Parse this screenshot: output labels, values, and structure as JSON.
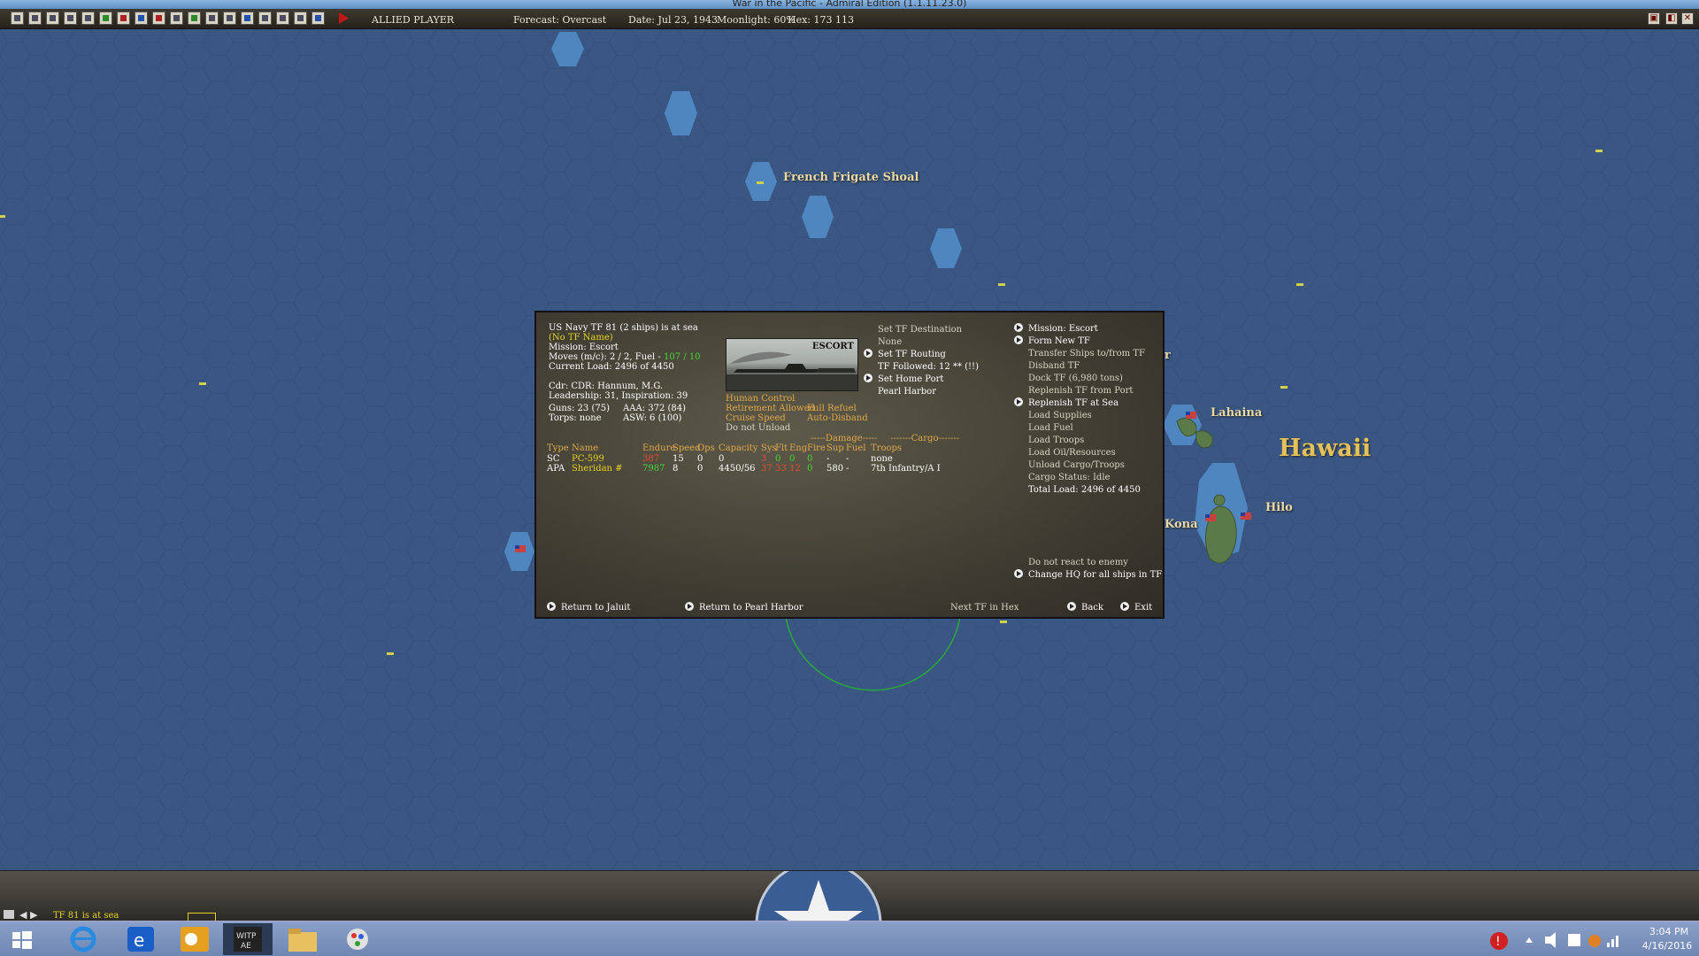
{
  "window": {
    "title": "War in the Pacific - Admiral Edition (1.1.11.23.0)"
  },
  "toolbar": {
    "player": "ALLIED PLAYER",
    "forecast": "Forecast: Overcast",
    "date": "Date: Jul 23, 1943",
    "moonlight": "Moonlight: 60%",
    "hex": "Hex: 173 113"
  },
  "map": {
    "labels": {
      "french_frigate_shoal": "French Frigate Shoal",
      "lahaina": "Lahaina",
      "hawaii": "Hawaii",
      "hilo": "Hilo",
      "kona": "Kona",
      "partial_r": "r"
    }
  },
  "panel": {
    "header": {
      "line1": "US Navy TF 81 (2 ships) is at sea",
      "tf_name": "(No TF Name)",
      "mission": "Mission: Escort",
      "moves_prefix": "Moves (m/c): 2 / 2, Fuel -",
      "moves_fuel": "107 / 10",
      "current_load": "Current Load: 2496 of 4450",
      "cdr": "Cdr: CDR: Hannum, M.G.",
      "leadership": "Leadership: 31, Inspiration: 39",
      "guns": "Guns: 23 (75)",
      "aaa": "AAA: 372 (84)",
      "torps": "Torps: none",
      "asw": "ASW: 6 (100)"
    },
    "image_label": "ESCORT",
    "settings": {
      "human_control": "Human Control",
      "retirement": "Retirement Allowed",
      "cruise": "Cruise Speed",
      "unload": "Do not Unload",
      "refuel": "Full Refuel",
      "disband": "Auto-Disband"
    },
    "middle": {
      "set_dest": "Set TF Destination",
      "none": "None",
      "set_routing": "Set TF Routing",
      "tf_followed": "TF Followed: 12 ** (!!)",
      "set_home": "Set Home Port",
      "home_port": "Pearl Harbor"
    },
    "right": {
      "mission": "Mission: Escort",
      "form_new": "Form New TF",
      "transfer": "Transfer Ships to/from TF",
      "disband": "Disband TF",
      "dock": "Dock TF (6,980 tons)",
      "replenish_port": "Replenish TF from Port",
      "replenish_sea": "Replenish TF at Sea",
      "load_supplies": "Load Supplies",
      "load_fuel": "Load Fuel",
      "load_troops": "Load Troops",
      "load_oil": "Load Oil/Resources",
      "unload_cargo": "Unload Cargo/Troops",
      "cargo_status": "Cargo Status: Idle",
      "total_load": "Total Load: 2496 of 4450",
      "no_react": "Do not react to enemy",
      "change_hq": "Change HQ for all ships in TF"
    },
    "table": {
      "damage_header": "-----Damage-----",
      "cargo_header": "-------Cargo-------",
      "columns": [
        "Type",
        "Name",
        "Endure",
        "Speed",
        "Ops",
        "Capacity",
        "Sys",
        "Flt",
        "Eng",
        "Fire",
        "Sup",
        "Fuel",
        "Troops"
      ],
      "rows": [
        [
          "SC",
          "PC-599",
          "387",
          "15",
          "0",
          "0",
          "3",
          "0",
          "0",
          "0",
          "-",
          "-",
          "none"
        ],
        [
          "APA",
          "Sheridan #",
          "7987",
          "8",
          "0",
          "4450/56",
          "37",
          "33",
          "12",
          "0",
          "580",
          "-",
          "7th Infantry/A I"
        ]
      ]
    },
    "footer": {
      "return_jaluit": "Return to Jaluit",
      "return_pearl": "Return to Pearl Harbor",
      "next_tf": "Next TF in Hex",
      "back": "Back",
      "exit": "Exit"
    }
  },
  "status": {
    "message": "TF 81 is at sea"
  },
  "taskbar": {
    "time": "3:04 PM",
    "date": "4/16/2016"
  }
}
